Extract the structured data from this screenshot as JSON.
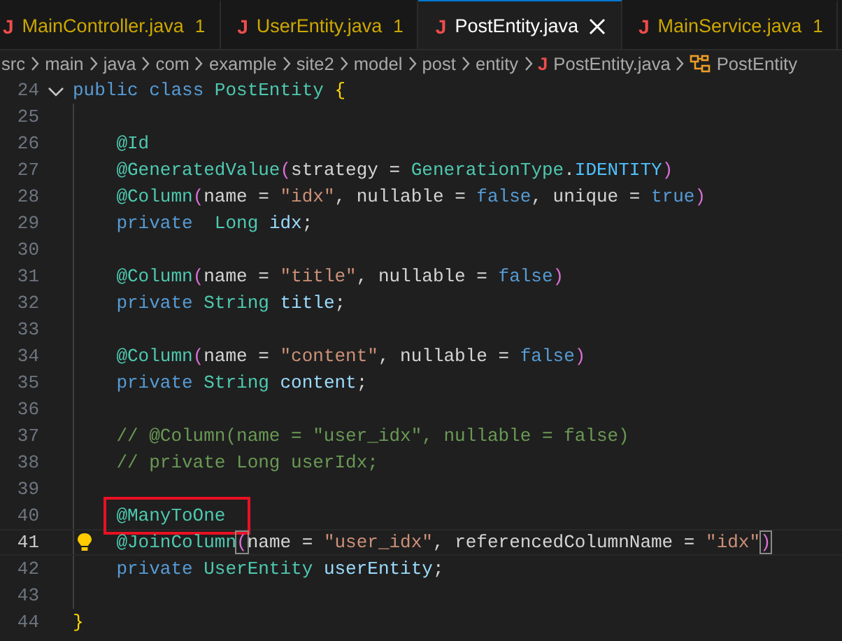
{
  "tabs": [
    {
      "file_icon": "J",
      "label": "MainController.java",
      "problems": "1",
      "selected": false
    },
    {
      "file_icon": "J",
      "label": "UserEntity.java",
      "problems": "1",
      "selected": false
    },
    {
      "file_icon": "J",
      "label": "PostEntity.java",
      "selected": true
    },
    {
      "file_icon": "J",
      "label": "MainService.java",
      "problems": "1",
      "selected": false
    }
  ],
  "breadcrumb": [
    {
      "label": "src"
    },
    {
      "label": "main"
    },
    {
      "label": "java"
    },
    {
      "label": "com"
    },
    {
      "label": "example"
    },
    {
      "label": "site2"
    },
    {
      "label": "model"
    },
    {
      "label": "post"
    },
    {
      "label": "entity"
    },
    {
      "kind": "file",
      "file_icon": "J",
      "label": "PostEntity.java"
    },
    {
      "kind": "class",
      "label": "PostEntity"
    }
  ],
  "editor": {
    "lines": [
      {
        "number": "24",
        "current": false,
        "expanded": true,
        "tokens": [
          {
            "kind": "kw",
            "text": "public "
          },
          {
            "kind": "kw",
            "text": "class "
          },
          {
            "kind": "type",
            "text": "PostEntity "
          },
          {
            "kind": "brace",
            "text": "{"
          }
        ],
        "children": [
          {
            "number": "25",
            "current": false
          },
          {
            "number": "26",
            "current": false,
            "tokens": [
              {
                "kind": "ann",
                "text": "@Id"
              }
            ]
          },
          {
            "number": "27",
            "current": false,
            "tokens": [
              {
                "kind": "ann",
                "text": "@GeneratedValue"
              },
              {
                "kind": "paren",
                "text": "("
              },
              {
                "kind": "plain",
                "text": "strategy = "
              },
              {
                "kind": "type",
                "text": "GenerationType"
              },
              {
                "kind": "plain",
                "text": "."
              },
              {
                "kind": "const",
                "text": "IDENTITY"
              },
              {
                "kind": "paren",
                "text": ")"
              }
            ]
          },
          {
            "number": "28",
            "current": false,
            "tokens": [
              {
                "kind": "ann",
                "text": "@Column"
              },
              {
                "kind": "paren",
                "text": "("
              },
              {
                "kind": "plain",
                "text": "name = "
              },
              {
                "kind": "str",
                "text": "\"idx\""
              },
              {
                "kind": "plain",
                "text": ", nullable = "
              },
              {
                "kind": "kw",
                "text": "false"
              },
              {
                "kind": "plain",
                "text": ", unique = "
              },
              {
                "kind": "kw",
                "text": "true"
              },
              {
                "kind": "paren",
                "text": ")"
              }
            ]
          },
          {
            "number": "29",
            "current": false,
            "tokens": [
              {
                "kind": "kw",
                "text": "private  "
              },
              {
                "kind": "type",
                "text": "Long "
              },
              {
                "kind": "var",
                "text": "idx"
              },
              {
                "kind": "plain",
                "text": ";"
              }
            ]
          },
          {
            "number": "30",
            "current": false
          },
          {
            "number": "31",
            "current": false,
            "tokens": [
              {
                "kind": "ann",
                "text": "@Column"
              },
              {
                "kind": "paren",
                "text": "("
              },
              {
                "kind": "plain",
                "text": "name = "
              },
              {
                "kind": "str",
                "text": "\"title\""
              },
              {
                "kind": "plain",
                "text": ", nullable = "
              },
              {
                "kind": "kw",
                "text": "false"
              },
              {
                "kind": "paren",
                "text": ")"
              }
            ]
          },
          {
            "number": "32",
            "current": false,
            "tokens": [
              {
                "kind": "kw",
                "text": "private "
              },
              {
                "kind": "type",
                "text": "String "
              },
              {
                "kind": "var",
                "text": "title"
              },
              {
                "kind": "plain",
                "text": ";"
              }
            ]
          },
          {
            "number": "33",
            "current": false
          },
          {
            "number": "34",
            "current": false,
            "tokens": [
              {
                "kind": "ann",
                "text": "@Column"
              },
              {
                "kind": "paren",
                "text": "("
              },
              {
                "kind": "plain",
                "text": "name = "
              },
              {
                "kind": "str",
                "text": "\"content\""
              },
              {
                "kind": "plain",
                "text": ", nullable = "
              },
              {
                "kind": "kw",
                "text": "false"
              },
              {
                "kind": "paren",
                "text": ")"
              }
            ]
          },
          {
            "number": "35",
            "current": false,
            "tokens": [
              {
                "kind": "kw",
                "text": "private "
              },
              {
                "kind": "type",
                "text": "String "
              },
              {
                "kind": "var",
                "text": "content"
              },
              {
                "kind": "plain",
                "text": ";"
              }
            ]
          },
          {
            "number": "36",
            "current": false
          },
          {
            "number": "37",
            "current": false,
            "tokens": [
              {
                "kind": "comment",
                "text": "// @Column(name = \"user_idx\", nullable = false)"
              }
            ]
          },
          {
            "number": "38",
            "current": false,
            "tokens": [
              {
                "kind": "comment",
                "text": "// private Long userIdx;"
              }
            ]
          },
          {
            "number": "39",
            "current": false
          },
          {
            "number": "40",
            "current": false,
            "tokens": [
              {
                "kind": "ann",
                "text": "@ManyToOne",
                "highlighted": true
              }
            ]
          },
          {
            "number": "41",
            "current": true,
            "lightbulb": true,
            "tokens": [
              {
                "kind": "ann",
                "text": "@JoinColumn"
              },
              {
                "kind": "paren",
                "text": "(",
                "matched": true
              },
              {
                "kind": "plain",
                "text": "name = "
              },
              {
                "kind": "str",
                "text": "\"user_idx\""
              },
              {
                "kind": "plain",
                "text": ", referencedColumnName = "
              },
              {
                "kind": "str",
                "text": "\"idx\""
              },
              {
                "kind": "paren",
                "text": ")",
                "matched": true
              }
            ]
          },
          {
            "number": "42",
            "current": false,
            "tokens": [
              {
                "kind": "kw",
                "text": "private "
              },
              {
                "kind": "type",
                "text": "UserEntity "
              },
              {
                "kind": "var",
                "text": "userEntity"
              },
              {
                "kind": "plain",
                "text": ";"
              }
            ]
          },
          {
            "number": "43",
            "current": false
          }
        ]
      },
      {
        "number": "44",
        "current": false,
        "tokens": [
          {
            "kind": "brace",
            "text": "}"
          }
        ]
      }
    ]
  }
}
